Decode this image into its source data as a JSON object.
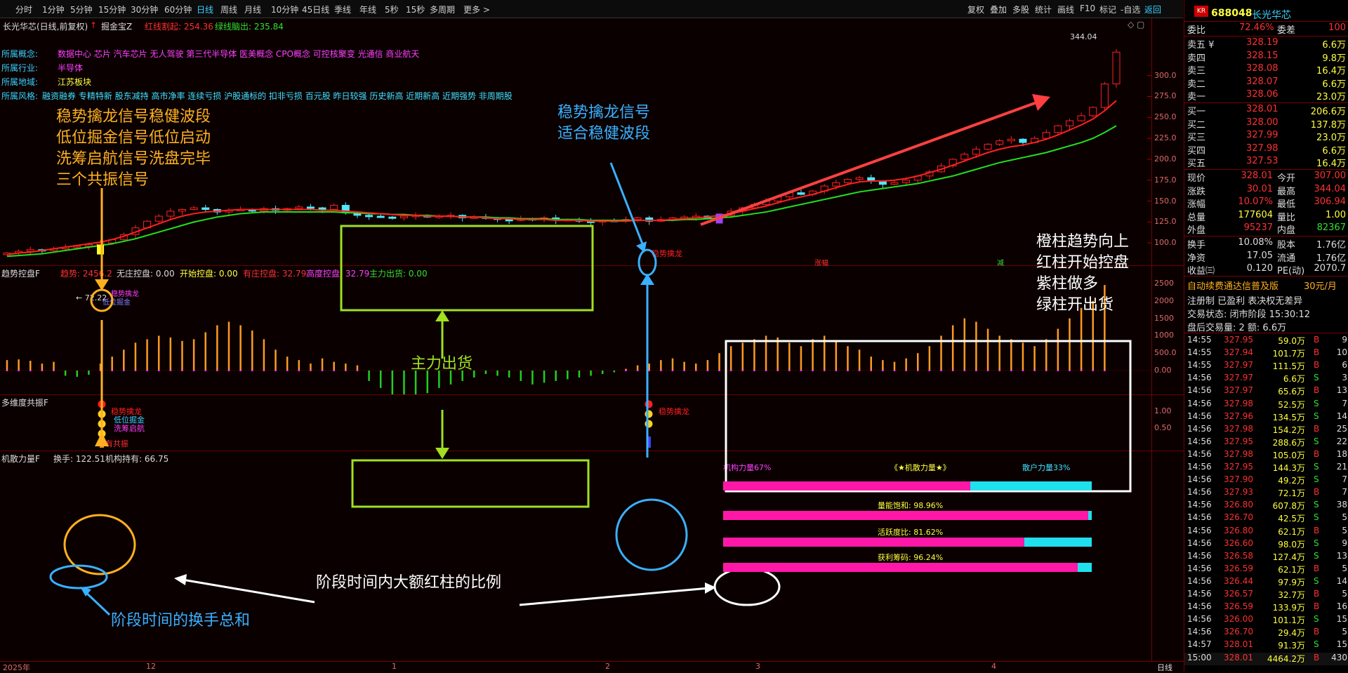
{
  "toolbar": {
    "periods": [
      "分时",
      "1分钟",
      "5分钟",
      "15分钟",
      "30分钟",
      "60分钟",
      "日线",
      "周线",
      "月线",
      "10分钟",
      "45日线",
      "季线",
      "年线",
      "5秒",
      "15秒",
      "多周期",
      "更多 >"
    ],
    "active_period": "日线",
    "right": [
      "复权",
      "叠加",
      "多股",
      "统计",
      "画线",
      "F10",
      "标记",
      "-自选",
      "返回"
    ]
  },
  "main_pane": {
    "title": "长光华芯(日线,前复权)",
    "indicator": "掘金宝Z",
    "red_label": "红线割起: 254.36",
    "green_label": "绿线脑出: 235.84",
    "concept_label": "所属概念:",
    "concept_value": "数据中心 芯片 汽车芯片 无人驾驶 第三代半导体 医美概念 CPO概念 可控核聚变 光通信 商业航天",
    "industry_label": "所属行业:",
    "industry_value": "半导体",
    "region_label": "所属地域:",
    "region_value": "江苏板块",
    "style_label": "所属风格:",
    "style_value": "融资融券 专精特新 股东减持 高市净率 连续亏损 沪股通标的 扣非亏损 百元股 昨日较强 历史新高 近期新高 近期强势 非周期股",
    "high_label": "344.04",
    "low_label": "← 72.22",
    "yticks": [
      "300.0",
      "275.0",
      "250.0",
      "225.0",
      "200.0",
      "175.0",
      "150.0",
      "125.0",
      "100.0"
    ],
    "signal_tag_1": "稳势擒龙",
    "signal_tag_2": "稳势擒龙",
    "signal_tag_3": "低位掘金"
  },
  "annotations": {
    "left_block": [
      "稳势擒龙信号稳健波段",
      "低位掘金信号低位启动",
      "洗筹启航信号洗盘完毕",
      "三个共振信号"
    ],
    "mid_block": [
      "稳势擒龙信号",
      "适合稳健波段"
    ],
    "right_block": [
      "橙柱趋势向上",
      "红柱开始控盘",
      "紫柱做多",
      "绿柱开出货"
    ],
    "main_out": "主力出货",
    "ratio": "阶段时间内大额红柱的比例",
    "turnover": "阶段时间的换手总和"
  },
  "pane2": {
    "title": "趋势控盘F",
    "trend": "趋势: 2456.2",
    "items": [
      "无庄控盘: 0.00",
      "开始控盘: 0.00",
      "有庄控盘: 32.79",
      "高度控盘: 32.79",
      "主力出货: 0.00"
    ],
    "yticks": [
      "2500",
      "2000",
      "1500",
      "1000",
      "500.0",
      "0.00"
    ],
    "top_marks": [
      "涨幅",
      "减"
    ]
  },
  "pane3": {
    "title": "多维度共振F",
    "tags_left": [
      "稳势擒龙",
      "低位掘金",
      "洗筹启航",
      "有共振"
    ],
    "tags_right": [
      "稳势擒龙"
    ],
    "yticks": [
      "1.00",
      "0.50"
    ]
  },
  "pane4": {
    "title": "机散力量F",
    "turnover": "换手: 122.51",
    "holding": "机构持有: 66.75",
    "inst_power": "机构力量67%",
    "center_title": "《★机散力量★》",
    "retail": "散户力量33%",
    "rows": [
      {
        "label": "机构力量",
        "pct": 67
      },
      {
        "label": "量能饱和:  98.96%",
        "pct": 98.96
      },
      {
        "label": "活跃度比:  81.62%",
        "pct": 81.62
      },
      {
        "label": "获利筹码:  96.24%",
        "pct": 96.24
      }
    ]
  },
  "xaxis": {
    "labels": [
      "2025年",
      "12",
      "1",
      "2",
      "3",
      "4"
    ],
    "period": "日线"
  },
  "quote": {
    "code": "688048",
    "name": "长光华芯",
    "badge": "KR",
    "weibi_label": "委比",
    "weibi": "72.46%",
    "weicha_label": "委差",
    "weicha": "100",
    "sell": [
      {
        "label": "卖五",
        "mark": "¥",
        "price": "328.19",
        "vol": "6.6万"
      },
      {
        "label": "卖四",
        "mark": "",
        "price": "328.15",
        "vol": "9.8万"
      },
      {
        "label": "卖三",
        "mark": "",
        "price": "328.08",
        "vol": "16.4万"
      },
      {
        "label": "卖二",
        "mark": "",
        "price": "328.07",
        "vol": "6.6万"
      },
      {
        "label": "卖一",
        "mark": "",
        "price": "328.06",
        "vol": "23.0万"
      }
    ],
    "buy": [
      {
        "label": "买一",
        "price": "328.01",
        "vol": "206.6万"
      },
      {
        "label": "买二",
        "price": "328.00",
        "vol": "137.8万"
      },
      {
        "label": "买三",
        "price": "327.99",
        "vol": "23.0万"
      },
      {
        "label": "买四",
        "price": "327.98",
        "vol": "6.6万"
      },
      {
        "label": "买五",
        "price": "327.53",
        "vol": "16.4万"
      }
    ],
    "stats": [
      {
        "l1": "现价",
        "v1": "328.01",
        "l2": "今开",
        "v2": "307.00"
      },
      {
        "l1": "涨跌",
        "v1": "30.01",
        "l2": "最高",
        "v2": "344.04"
      },
      {
        "l1": "涨幅",
        "v1": "10.07%",
        "l2": "最低",
        "v2": "306.94"
      },
      {
        "l1": "总量",
        "v1": "177604",
        "l2": "量比",
        "v2": "1.00"
      },
      {
        "l1": "外盘",
        "v1": "95237",
        "l2": "内盘",
        "v2": "82367"
      }
    ],
    "stats2": [
      {
        "l1": "换手",
        "v1": "10.08%",
        "l2": "股本",
        "v2": "1.76亿"
      },
      {
        "l1": "净资",
        "v1": "17.05",
        "l2": "流通",
        "v2": "1.76亿"
      },
      {
        "l1": "收益㈢",
        "v1": "0.120",
        "l2": "PE(动)",
        "v2": "2070.7"
      }
    ],
    "promo": "自动续费通达信普及版",
    "promo_price": "30元/月",
    "reg": "注册制 已盈利 表决权无差异",
    "status": "交易状态: 闭市阶段 15:30:12",
    "after": "盘后交易量: 2  额: 6.6万"
  },
  "ticks": [
    [
      "14:55",
      "327.95",
      "59.0万",
      "B",
      "9"
    ],
    [
      "14:55",
      "327.94",
      "101.7万",
      "B",
      "10"
    ],
    [
      "14:55",
      "327.97",
      "111.5万",
      "B",
      "6"
    ],
    [
      "14:56",
      "327.97",
      "6.6万",
      "S",
      "3"
    ],
    [
      "14:56",
      "327.97",
      "65.6万",
      "B",
      "13"
    ],
    [
      "14:56",
      "327.98",
      "52.5万",
      "S",
      "7"
    ],
    [
      "14:56",
      "327.96",
      "134.5万",
      "S",
      "14"
    ],
    [
      "14:56",
      "327.98",
      "154.2万",
      "B",
      "25"
    ],
    [
      "14:56",
      "327.95",
      "288.6万",
      "S",
      "22"
    ],
    [
      "14:56",
      "327.98",
      "105.0万",
      "B",
      "18"
    ],
    [
      "14:56",
      "327.95",
      "144.3万",
      "S",
      "21"
    ],
    [
      "14:56",
      "327.90",
      "49.2万",
      "S",
      "7"
    ],
    [
      "14:56",
      "327.93",
      "72.1万",
      "B",
      "7"
    ],
    [
      "14:56",
      "326.80",
      "607.8万",
      "S",
      "38"
    ],
    [
      "14:56",
      "326.70",
      "42.5万",
      "S",
      "5"
    ],
    [
      "14:56",
      "326.80",
      "62.1万",
      "B",
      "5"
    ],
    [
      "14:56",
      "326.60",
      "98.0万",
      "S",
      "9"
    ],
    [
      "14:56",
      "326.58",
      "127.4万",
      "S",
      "13"
    ],
    [
      "14:56",
      "326.59",
      "62.1万",
      "B",
      "5"
    ],
    [
      "14:56",
      "326.44",
      "97.9万",
      "S",
      "14"
    ],
    [
      "14:56",
      "326.57",
      "32.7万",
      "B",
      "5"
    ],
    [
      "14:56",
      "326.59",
      "133.9万",
      "B",
      "16"
    ],
    [
      "14:56",
      "326.00",
      "101.1万",
      "S",
      "15"
    ],
    [
      "14:56",
      "326.70",
      "29.4万",
      "B",
      "5"
    ],
    [
      "14:57",
      "328.01",
      "91.3万",
      "S",
      "15"
    ],
    [
      "15:00",
      "328.01",
      "4464.2万",
      "B",
      "430"
    ]
  ],
  "chart_data": {
    "type": "candlestick",
    "x": [
      "2025-11",
      "2025-12",
      "2026-01",
      "2026-02",
      "2026-03",
      "2026-04"
    ],
    "high": 344.04,
    "low": 72.22,
    "ylim": [
      75,
      345
    ],
    "closes": [
      88,
      90,
      92,
      91,
      93,
      95,
      96,
      98,
      100,
      104,
      110,
      118,
      126,
      132,
      138,
      140,
      142,
      140,
      137,
      139,
      140,
      138,
      141,
      139,
      141,
      143,
      142,
      140,
      145,
      136,
      133,
      132,
      131,
      130,
      132,
      133,
      131,
      132,
      133,
      130,
      131,
      130,
      128,
      127,
      129,
      128,
      130,
      127,
      128,
      126,
      125,
      127,
      126,
      128,
      130,
      126,
      128,
      130,
      131,
      132,
      129,
      133,
      138,
      142,
      146,
      150,
      155,
      160,
      158,
      162,
      168,
      172,
      176,
      178,
      174,
      170,
      172,
      175,
      180,
      185,
      192,
      200,
      206,
      212,
      218,
      222,
      224,
      220,
      225,
      232,
      240,
      246,
      252,
      262,
      290,
      328
    ],
    "ma_red": [
      86,
      88,
      89,
      91,
      93,
      95,
      97,
      99,
      101,
      104,
      108,
      113,
      118,
      123,
      128,
      132,
      135,
      137,
      138,
      139,
      140,
      140,
      140,
      140,
      140,
      140,
      140,
      139,
      139,
      138,
      137,
      136,
      135,
      134,
      133,
      133,
      132,
      132,
      132,
      131,
      131,
      130,
      129,
      129,
      128,
      128,
      128,
      127,
      127,
      127,
      126,
      126,
      126,
      126,
      127,
      127,
      127,
      128,
      129,
      130,
      131,
      133,
      135,
      138,
      141,
      144,
      148,
      152,
      155,
      158,
      162,
      166,
      170,
      173,
      174,
      174,
      175,
      177,
      180,
      184,
      188,
      193,
      198,
      203,
      208,
      212,
      215,
      217,
      220,
      224,
      229,
      235,
      241,
      248,
      258,
      270
    ],
    "ma_green": [
      84,
      85,
      86,
      87,
      89,
      91,
      93,
      95,
      97,
      99,
      102,
      105,
      109,
      113,
      117,
      121,
      125,
      128,
      131,
      133,
      135,
      136,
      137,
      137,
      137,
      137,
      137,
      137,
      137,
      136,
      136,
      135,
      135,
      134,
      134,
      133,
      133,
      132,
      132,
      131,
      131,
      131,
      130,
      130,
      129,
      129,
      129,
      128,
      128,
      128,
      127,
      127,
      127,
      127,
      127,
      127,
      127,
      127,
      128,
      128,
      129,
      130,
      131,
      133,
      135,
      137,
      140,
      143,
      146,
      149,
      152,
      155,
      158,
      161,
      163,
      165,
      167,
      169,
      171,
      174,
      177,
      180,
      184,
      188,
      192,
      196,
      199,
      202,
      205,
      208,
      212,
      216,
      220,
      225,
      232,
      240
    ],
    "trend_bars": [
      300,
      320,
      280,
      200,
      250,
      -150,
      -180,
      -120,
      200,
      400,
      600,
      800,
      900,
      1000,
      950,
      850,
      900,
      1100,
      1300,
      1400,
      1300,
      1150,
      900,
      600,
      400,
      300,
      200,
      350,
      250,
      200,
      150,
      -300,
      -500,
      -700,
      -850,
      -800,
      -650,
      -500,
      -400,
      -300,
      -200,
      -100,
      -150,
      -200,
      -300,
      -400,
      -350,
      -300,
      -250,
      -200,
      -150,
      -100,
      -50,
      50,
      150,
      200,
      300,
      350,
      250,
      200,
      300,
      500,
      700,
      800,
      900,
      1000,
      950,
      800,
      700,
      900,
      1000,
      850,
      700,
      600,
      400,
      300,
      250,
      350,
      500,
      700,
      1000,
      1300,
      1500,
      1400,
      1200,
      1000,
      900,
      800,
      700,
      900,
      1200,
      1500,
      1800,
      2000,
      2456
    ]
  }
}
